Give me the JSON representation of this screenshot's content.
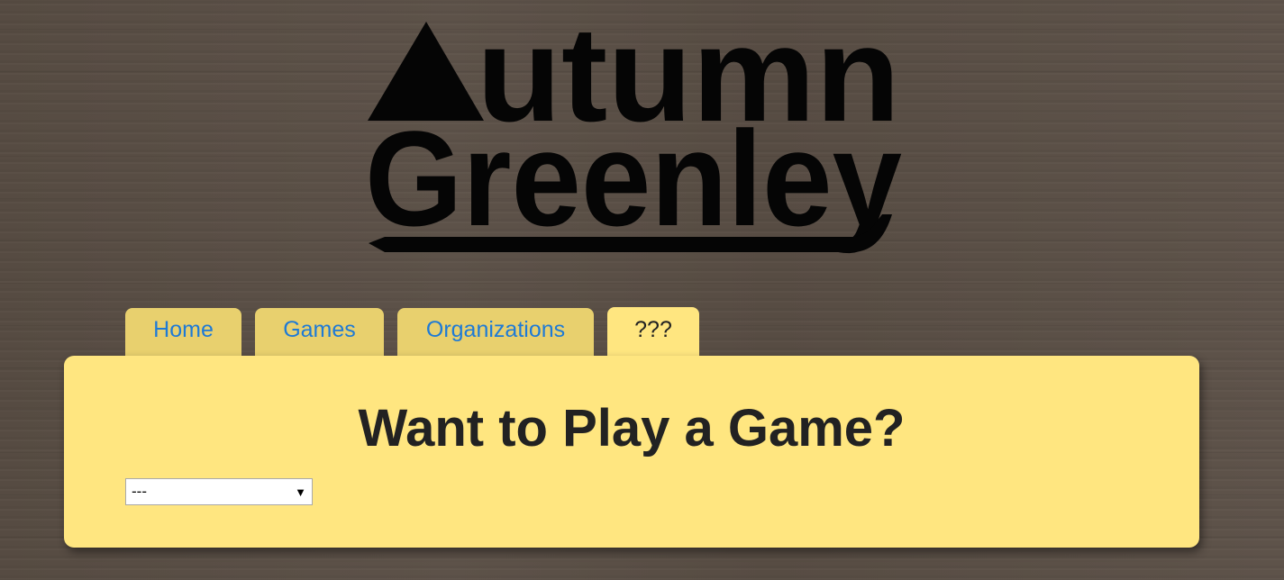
{
  "logo": {
    "line1": "utumn",
    "line2": "Greenley",
    "color": "#050505"
  },
  "nav": {
    "tabs": [
      {
        "label": "Home",
        "active": false
      },
      {
        "label": "Games",
        "active": false
      },
      {
        "label": "Organizations",
        "active": false
      },
      {
        "label": "???",
        "active": true
      }
    ]
  },
  "main": {
    "title": "Want to Play a Game?",
    "select": {
      "value": "---",
      "arrow_icon": "dropdown-triangle-icon"
    }
  },
  "colors": {
    "background": "#5a4f46",
    "tab": "#e8d06e",
    "panel": "#ffe680",
    "link": "#1e7ad6",
    "text": "#222222"
  }
}
